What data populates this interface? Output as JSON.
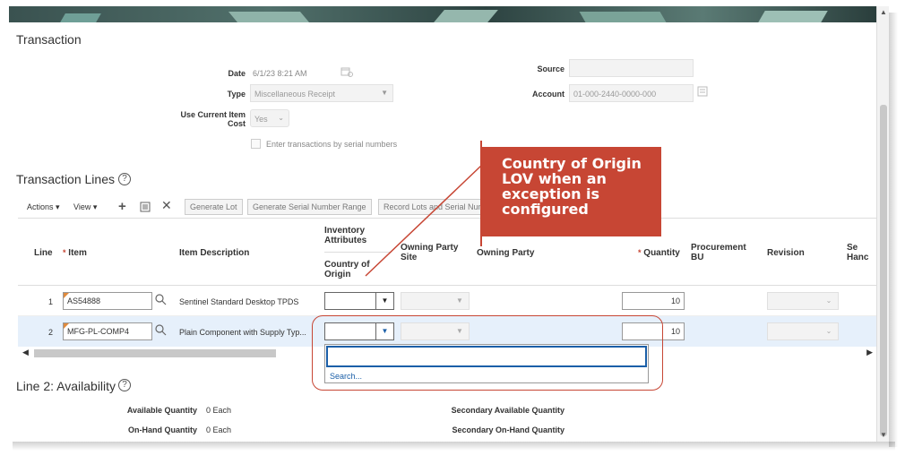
{
  "transaction": {
    "title": "Transaction",
    "date_label": "Date",
    "date_value": "6/1/23 8:21 AM",
    "type_label": "Type",
    "type_value": "Miscellaneous Receipt",
    "use_cost_label_1": "Use Current Item",
    "use_cost_label_2": "Cost",
    "use_cost_value": "Yes",
    "serial_checkbox_label": "Enter transactions by serial numbers",
    "source_label": "Source",
    "source_value": "",
    "account_label": "Account",
    "account_value": "01-000-2440-0000-000"
  },
  "lines": {
    "title": "Transaction Lines",
    "toolbar": {
      "actions": "Actions ▾",
      "view": "View ▾",
      "generate_lot": "Generate Lot",
      "generate_serial": "Generate Serial Number Range",
      "record_lots": "Record Lots and Serial Num"
    },
    "headers": {
      "line": "Line",
      "item": "Item",
      "item_description": "Item Description",
      "inventory_attributes_1": "Inventory",
      "inventory_attributes_2": "Attributes",
      "country_origin_1": "Country of",
      "country_origin_2": "Origin",
      "owning_party_site_1": "Owning Party",
      "owning_party_site_2": "Site",
      "owning_party": "Owning Party",
      "quantity": "Quantity",
      "procurement_bu_1": "Procurement",
      "procurement_bu_2": "BU",
      "revision": "Revision",
      "se_1": "Se",
      "se_2": "Hanc"
    },
    "rows": [
      {
        "line": "1",
        "item": "AS54888",
        "description": "Sentinel Standard Desktop TPDS",
        "quantity": "10"
      },
      {
        "line": "2",
        "item": "MFG-PL-COMP4",
        "description": "Plain Component with Supply Typ...",
        "quantity": "10"
      }
    ],
    "lov_search": "Search..."
  },
  "availability": {
    "title": "Line 2: Availability",
    "available_qty_label": "Available Quantity",
    "available_qty_value": "0 Each",
    "onhand_qty_label": "On-Hand Quantity",
    "onhand_qty_value": "0 Each",
    "secondary_available_label": "Secondary Available Quantity",
    "secondary_onhand_label": "Secondary On-Hand Quantity"
  },
  "callout": {
    "line1": "Country of Origin",
    "line2": "LOV when an",
    "line3": "exception is",
    "line4": "configured"
  },
  "colors": {
    "accent_red": "#c74634",
    "selected_row": "#e6f0fb",
    "link_blue": "#1b5fa8"
  }
}
